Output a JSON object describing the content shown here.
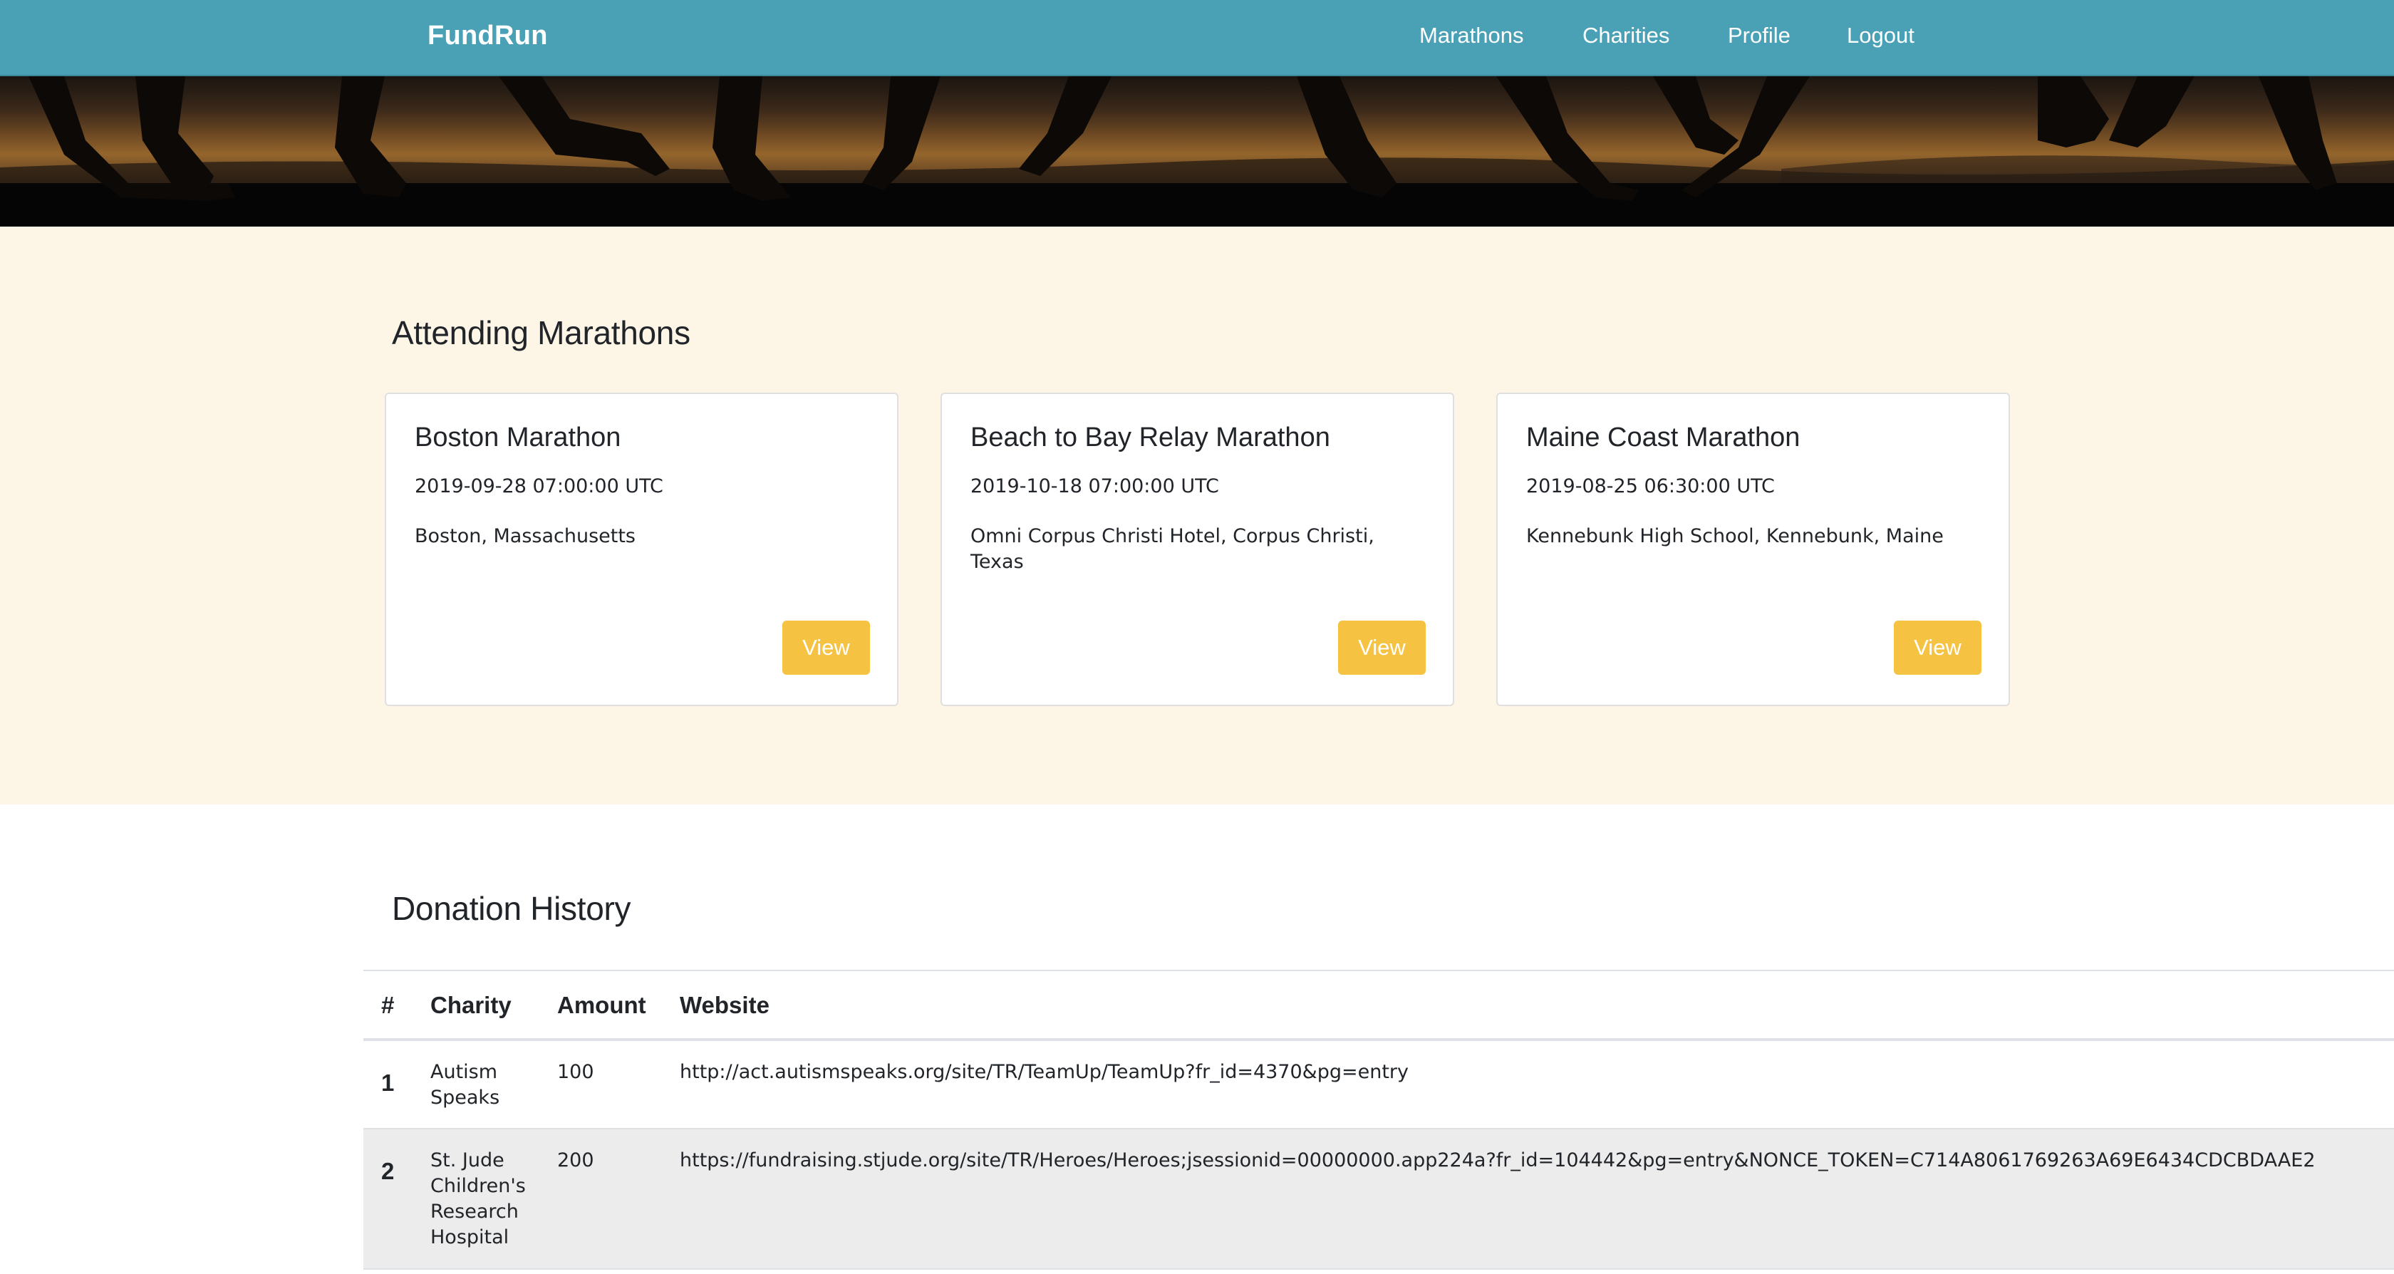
{
  "navbar": {
    "brand": "FundRun",
    "links": [
      "Marathons",
      "Charities",
      "Profile",
      "Logout"
    ],
    "background": "#4aa1b6"
  },
  "attending": {
    "title": "Attending Marathons",
    "background": "#fdf5e6",
    "cards": [
      {
        "title": "Boston Marathon",
        "date": "2019-09-28 07:00:00 UTC",
        "location": "Boston, Massachusetts",
        "button": "View"
      },
      {
        "title": "Beach to Bay Relay Marathon",
        "date": "2019-10-18 07:00:00 UTC",
        "location": "Omni Corpus Christi Hotel, Corpus Christi, Texas",
        "button": "View"
      },
      {
        "title": "Maine Coast Marathon",
        "date": "2019-08-25 06:30:00 UTC",
        "location": "Kennebunk High School, Kennebunk, Maine",
        "button": "View"
      }
    ],
    "button_color": "#f5c242"
  },
  "donations": {
    "title": "Donation History",
    "columns": [
      "#",
      "Charity",
      "Amount",
      "Website"
    ],
    "rows": [
      {
        "num": "1",
        "charity": "Autism Speaks",
        "amount": "100",
        "website": "http://act.autismspeaks.org/site/TR/TeamUp/TeamUp?fr_id=4370&pg=entry"
      },
      {
        "num": "2",
        "charity": "St. Jude Children's Research Hospital",
        "amount": "200",
        "website": "https://fundraising.stjude.org/site/TR/Heroes/Heroes;jsessionid=00000000.app224a?fr_id=104442&pg=entry&NONCE_TOKEN=C714A8061769263A69E6434CDCBDAAE2"
      }
    ]
  },
  "hero": {
    "image": "runners-silhouette-sunset"
  }
}
